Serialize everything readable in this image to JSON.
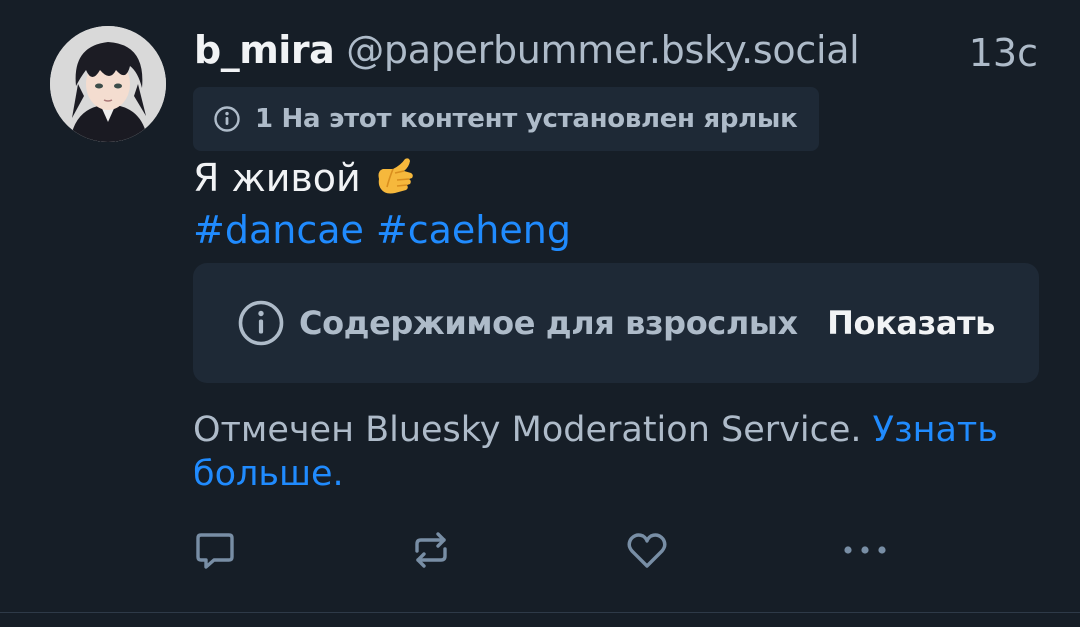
{
  "post": {
    "author": {
      "display_name": "b_mira",
      "handle": "@paperbummer.bsky.social"
    },
    "timestamp": "13с",
    "label_notice": "1 На этот контент установлен ярлык",
    "text_line": "Я живой",
    "emoji": "call-me-hand-emoji",
    "hashtags": [
      "#dancae",
      "#caeheng"
    ],
    "content_warning": {
      "label": "Содержимое для взрослых",
      "show_button": "Показать"
    },
    "moderation_note": {
      "text": "Отмечен Bluesky Moderation Service.",
      "link": "Узнать больше."
    },
    "actions": [
      "reply-icon",
      "repost-icon",
      "like-icon",
      "more-icon"
    ]
  },
  "colors": {
    "background": "#161e27",
    "card": "#1e2936",
    "text_primary": "#f1f3f5",
    "text_secondary": "#aebbc9",
    "link": "#208bfe"
  }
}
